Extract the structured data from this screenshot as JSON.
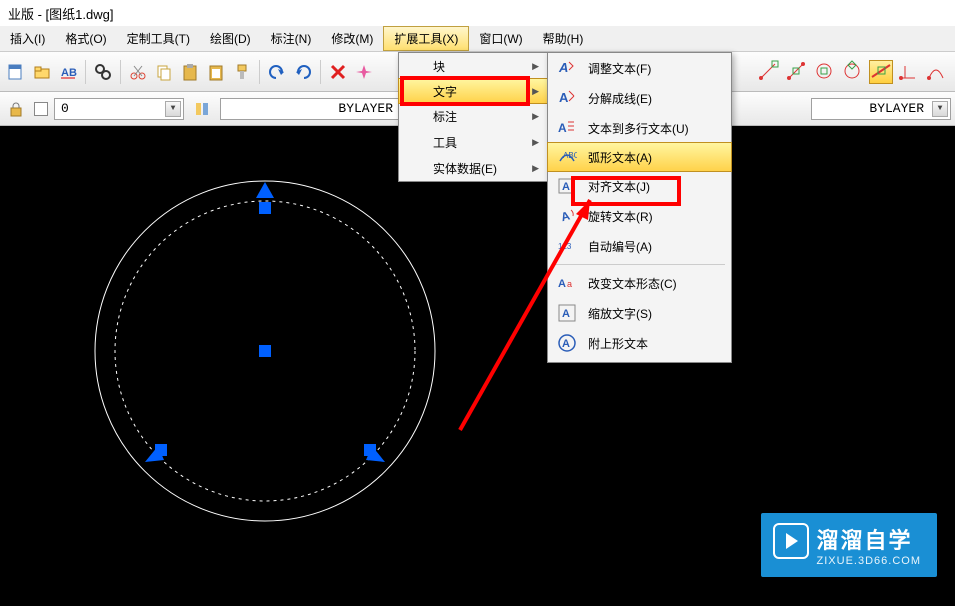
{
  "title": "业版 - [图纸1.dwg]",
  "menubar": {
    "insert": "插入(I)",
    "format": "格式(O)",
    "custom": "定制工具(T)",
    "draw": "绘图(D)",
    "dim": "标注(N)",
    "modify": "修改(M)",
    "ext": "扩展工具(X)",
    "window": "窗口(W)",
    "help": "帮助(H)"
  },
  "layer": {
    "name": "0"
  },
  "linetype1": "BYLAYER",
  "linetype2": "BYLAYER",
  "extmenu": {
    "block": "块",
    "text": "文字",
    "dim": "标注",
    "tool": "工具",
    "entity": "实体数据(E)"
  },
  "textmenu": {
    "adjust": "调整文本(F)",
    "explode": "分解成线(E)",
    "tomtext": "文本到多行文本(U)",
    "arc": "弧形文本(A)",
    "align": "对齐文本(J)",
    "rotate": "旋转文本(R)",
    "autonum": "自动编号(A)",
    "changestyle": "改变文本形态(C)",
    "scale": "缩放文字(S)",
    "attach": "附上形文本"
  },
  "watermark": {
    "title": "溜溜自学",
    "sub": "ZIXUE.3D66.COM"
  }
}
